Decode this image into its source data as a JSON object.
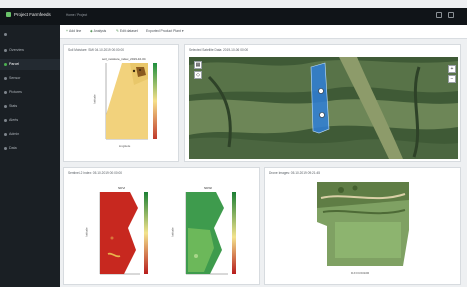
{
  "app": {
    "title": "Project Farmfeeds"
  },
  "topbar": {
    "breadcrumb": "Home  /  Project"
  },
  "sidebar": {
    "items": [
      {
        "label": "Overview",
        "icon": "dashboard-icon",
        "active": false
      },
      {
        "label": "Parcel",
        "icon": "parcel-icon",
        "active": true
      },
      {
        "label": "Sensor",
        "icon": "sensor-icon",
        "active": false
      },
      {
        "label": "Pictures",
        "icon": "image-icon",
        "active": false
      },
      {
        "label": "Stats",
        "icon": "chart-icon",
        "active": false
      },
      {
        "label": "Alerts",
        "icon": "bell-icon",
        "active": false
      },
      {
        "label": "Admin",
        "icon": "gear-icon",
        "active": false
      },
      {
        "label": "Data",
        "icon": "database-icon",
        "active": false
      }
    ]
  },
  "toolbar": {
    "add_label": "Add line",
    "analysis_label": "Analysis",
    "edit_label": "Edit dataset",
    "export_label": "Exported Product Plant"
  },
  "panels": {
    "soil": {
      "title": "Soil Moisture: SMI 04.10.2019 00:00:00",
      "plot_title": "soil_moisture_index_2019-10-04",
      "ylabel": "latitude",
      "xlabel": "longitude"
    },
    "map": {
      "title": "Selected Satellite Data: 2019-10-06 00:00"
    },
    "veg": {
      "title": "Sentinel-2 Index: 05.10.2019 00:00:00",
      "plot1_title": "NDVI",
      "plot2_title": "NDWI",
      "ylabel": "latitude"
    },
    "drone": {
      "title": "Drone Images: 05.10.2019 09:21:45",
      "caption": "DJI FC6310R"
    }
  },
  "colors": {
    "accent": "#4caf50",
    "sidebar_bg": "#1a1f24",
    "topbar_bg": "#101418",
    "selection": "#2f7fd8"
  }
}
